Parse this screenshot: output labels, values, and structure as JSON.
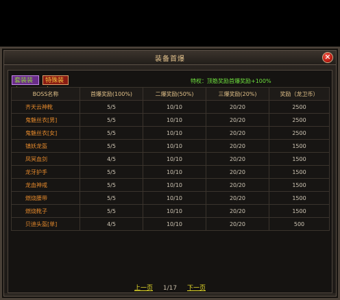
{
  "window": {
    "title": "装备首爆",
    "close_symbol": "✕"
  },
  "tabs": [
    {
      "label": "套装装备"
    },
    {
      "label": "特殊装备"
    }
  ],
  "privilege_text": "特权：顶筋奖励首爆奖励+100%",
  "table": {
    "headers": [
      "BOSS名称",
      "首爆奖励(100%)",
      "二爆奖励(50%)",
      "三爆奖励(20%)",
      "奖励（龙卫币）"
    ],
    "rows": [
      [
        "齐天云神靴",
        "5/5",
        "10/10",
        "20/20",
        "2500"
      ],
      [
        "鬼魅丝衣[男]",
        "5/5",
        "10/10",
        "20/20",
        "2500"
      ],
      [
        "鬼魅丝衣[女]",
        "5/5",
        "10/10",
        "20/20",
        "2500"
      ],
      [
        "镇妖龙盔",
        "5/5",
        "10/10",
        "20/20",
        "1500"
      ],
      [
        "凤冥血剑",
        "4/5",
        "10/10",
        "20/20",
        "1500"
      ],
      [
        "龙牙护手",
        "5/5",
        "10/10",
        "20/20",
        "1500"
      ],
      [
        "龙血神戒",
        "5/5",
        "10/10",
        "20/20",
        "1500"
      ],
      [
        "燃烧腰带",
        "5/5",
        "10/10",
        "20/20",
        "1500"
      ],
      [
        "燃烧靴子",
        "5/5",
        "10/10",
        "20/20",
        "1500"
      ],
      [
        "贝迪头盔[单]",
        "4/5",
        "10/10",
        "20/20",
        "500"
      ]
    ]
  },
  "pager": {
    "prev_label": "上一页",
    "page_info": "1/17",
    "next_label": "下一页"
  }
}
